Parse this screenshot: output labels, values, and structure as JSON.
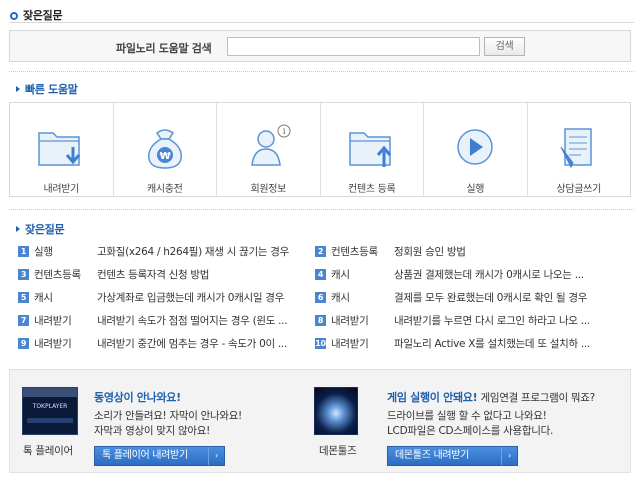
{
  "page_title": "잦은질문",
  "search": {
    "label": "파일노리 도움말 검색",
    "button": "검색",
    "value": ""
  },
  "quick": {
    "title": "빠른 도움말",
    "items": [
      {
        "label": "내려받기",
        "icon": "folder-download-icon"
      },
      {
        "label": "캐시충전",
        "icon": "money-bag-icon"
      },
      {
        "label": "회원정보",
        "icon": "user-info-icon"
      },
      {
        "label": "컨텐츠 등록",
        "icon": "folder-upload-icon"
      },
      {
        "label": "실행",
        "icon": "play-icon"
      },
      {
        "label": "상담글쓰기",
        "icon": "write-document-icon"
      }
    ]
  },
  "faq": {
    "title": "잦은질문",
    "items": [
      {
        "num": "1",
        "category": "실행",
        "question": "고화질(x264 / h264필) 재생 시 끊기는 경우"
      },
      {
        "num": "2",
        "category": "컨텐츠등록",
        "question": "정회원 승인 방법"
      },
      {
        "num": "3",
        "category": "컨텐츠등록",
        "question": "컨텐츠 등록자격 신청 방법"
      },
      {
        "num": "4",
        "category": "캐시",
        "question": "상품권 결제했는데 캐시가 0캐시로 나오는 ..."
      },
      {
        "num": "5",
        "category": "캐시",
        "question": "가상계좌로 입금했는데 캐시가 0캐시일 경우"
      },
      {
        "num": "6",
        "category": "캐시",
        "question": "결제를 모두 완료했는데 0캐시로 확인 될 경우"
      },
      {
        "num": "7",
        "category": "내려받기",
        "question": "내려받기 속도가 점점 떨어지는 경우 (윈도 ..."
      },
      {
        "num": "8",
        "category": "내려받기",
        "question": "내려받기를 누르면 다시 로그인 하라고 나오 ..."
      },
      {
        "num": "9",
        "category": "내려받기",
        "question": "내려받기 중간에 멈추는 경우 - 속도가 0이 ..."
      },
      {
        "num": "10",
        "category": "내려받기",
        "question": "파일노리 Active X를 설치했는데 또 설치하 ..."
      }
    ]
  },
  "promos": [
    {
      "name": "톡 플레이어",
      "image_text": "TOKPLAYER",
      "title": "동영상이 안나와요!",
      "title_extra": "",
      "desc1": "소리가 안들려요! 자막이 안나와요!",
      "desc2": "자막과 영상이 맞지 않아요!",
      "button": "톡 플레이어 내려받기"
    },
    {
      "name": "데몬툴즈",
      "image_text": "",
      "title": "게임 실행이 안돼요!",
      "title_extra": "게임연결 프로그램이 뭐죠?",
      "desc1": "드라이브를 실행 할 수 없다고 나와요!",
      "desc2": "LCD파일은 CD스페이스를 사용합니다.",
      "button": "데몬툴즈 내려받기"
    }
  ],
  "colors": {
    "accent": "#1f5fae",
    "icon_blue": "#4a86cf",
    "button_blue": "#2c6dc2"
  }
}
